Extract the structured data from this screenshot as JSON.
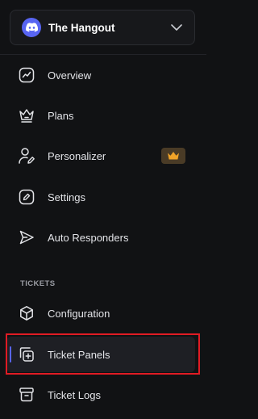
{
  "server": {
    "name": "The Hangout",
    "logo_icon": "discord-icon",
    "expand_icon": "chevron-down-icon"
  },
  "nav": {
    "items": [
      {
        "label": "Overview",
        "icon": "chart-line-icon"
      },
      {
        "label": "Plans",
        "icon": "crown-outline-icon"
      },
      {
        "label": "Personalizer",
        "icon": "user-edit-icon"
      },
      {
        "label": "Settings",
        "icon": "edit-square-icon"
      },
      {
        "label": "Auto Responders",
        "icon": "send-icon"
      }
    ],
    "premium_badge_icon": "crown-icon"
  },
  "tickets": {
    "section_title": "TICKETS",
    "items": [
      {
        "label": "Configuration",
        "icon": "cube-icon"
      },
      {
        "label": "Ticket Panels",
        "icon": "panel-add-icon",
        "active": true
      },
      {
        "label": "Ticket Logs",
        "icon": "archive-icon"
      }
    ]
  },
  "colors": {
    "background": "#111214",
    "accent": "#5865f2",
    "badge_background": "#4a3b26",
    "badge_crown": "#f0a328",
    "highlight_border": "#e01b24"
  }
}
